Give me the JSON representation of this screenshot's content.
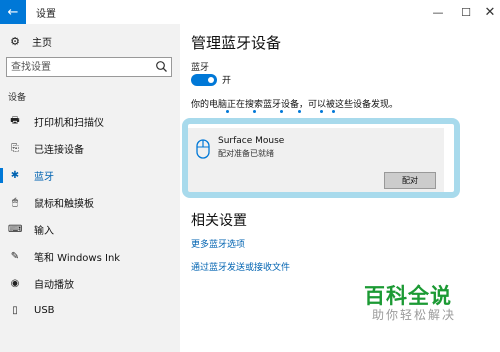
{
  "window": {
    "title": "设置",
    "back_icon": "←",
    "minimize_icon": "—",
    "maximize_icon": "☐",
    "close_icon": "✕"
  },
  "sidebar": {
    "home_icon": "⚙",
    "home_label": "主页",
    "search_placeholder": "查找设置",
    "section_label": "设备",
    "items": [
      {
        "icon": "🖶",
        "label": "打印机和扫描仪",
        "active": false
      },
      {
        "icon": "⎘",
        "label": "已连接设备",
        "active": false
      },
      {
        "icon": "✱",
        "label": "蓝牙",
        "active": true
      },
      {
        "icon": "🖱",
        "label": "鼠标和触摸板",
        "active": false
      },
      {
        "icon": "⌨",
        "label": "输入",
        "active": false
      },
      {
        "icon": "✎",
        "label": "笔和 Windows Ink",
        "active": false
      },
      {
        "icon": "◉",
        "label": "自动播放",
        "active": false
      },
      {
        "icon": "▯",
        "label": "USB",
        "active": false
      }
    ]
  },
  "main": {
    "title": "管理蓝牙设备",
    "bluetooth_label": "蓝牙",
    "toggle_state": "开",
    "toggle_on": true,
    "searching_text": "你的电脑正在搜索蓝牙设备，可以被这些设备发现。",
    "device": {
      "name": "Surface Mouse",
      "status": "配对准备已就绪",
      "pair_label": "配对",
      "icon": "mouse-icon"
    },
    "related_title": "相关设置",
    "links": [
      "更多蓝牙选项",
      "通过蓝牙发送或接收文件"
    ]
  },
  "colors": {
    "accent": "#0078d7",
    "link": "#0063b1",
    "sidebar_bg": "#f2f2f2",
    "highlight": "#9fd6ea",
    "watermark_green": "#1c9a34"
  },
  "watermark": {
    "title": "百科全说",
    "subtitle": "助你轻松解决"
  }
}
